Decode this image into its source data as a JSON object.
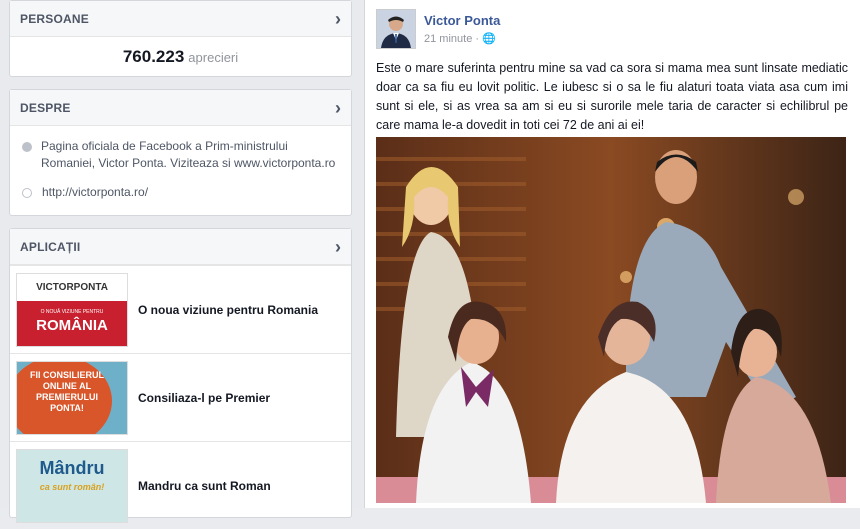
{
  "people": {
    "title": "PERSOANE",
    "likes_count": "760.223",
    "likes_label": "aprecieri"
  },
  "about": {
    "title": "DESPRE",
    "description": "Pagina oficiala de Facebook a Prim-ministrului Romaniei, Victor Ponta. Viziteaza si www.victorponta.ro",
    "website": "http://victorponta.ro/"
  },
  "apps": {
    "title": "APLICAȚII",
    "items": [
      {
        "label": "O noua viziune pentru Romania",
        "thumb_top": "VICTORPONTA",
        "thumb_sub": "O NOUĂ VIZIUNE PENTRU",
        "thumb_main": "ROMÂNIA"
      },
      {
        "label": "Consiliaza-l pe Premier",
        "thumb_text": "FII CONSILIERUL ONLINE AL PREMIERULUI PONTA!"
      },
      {
        "label": "Mandru ca sunt Roman",
        "thumb_main": "Mândru",
        "thumb_sub": "ca sunt român!"
      }
    ]
  },
  "post": {
    "author": "Victor Ponta",
    "time": "21 minute",
    "text": "Este o mare suferinta pentru mine sa vad ca sora si mama mea sunt linsate mediatic doar ca sa fiu eu lovit politic. Le iubesc si o sa le fiu alaturi toata viata asa cum imi sunt si ele, si as vrea sa am si eu si surorile mele taria de caracter si echilibrul pe care mama le-a dovedit in toti cei 72 de ani ai ei!"
  },
  "colors": {
    "link": "#3b5998",
    "header_bg": "#f6f7f9",
    "app_red": "#c8202f"
  }
}
